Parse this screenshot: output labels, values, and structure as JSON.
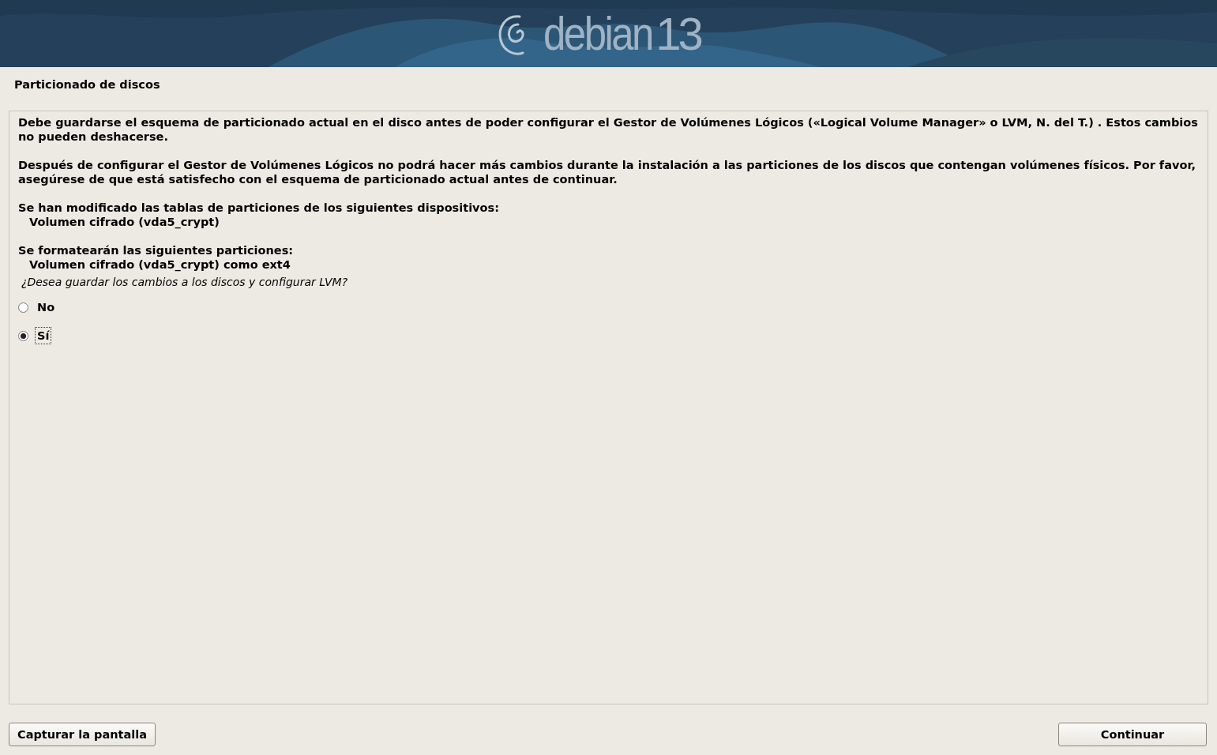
{
  "banner": {
    "brand": "debian",
    "version": "13"
  },
  "title": "Particionado de discos",
  "message": [
    {
      "kind": "paragraph",
      "text": "Debe guardarse el esquema de particionado actual en el disco antes de poder configurar el Gestor de Volúmenes Lógicos («Logical Volume Manager» o LVM, N. del T.) . Estos cambios no pueden deshacerse."
    },
    {
      "kind": "paragraph",
      "text": "Después de configurar el Gestor de Volúmenes Lógicos no podrá hacer más cambios durante la instalación a las particiones de los discos que contengan volúmenes físicos. Por favor, asegúrese de que está satisfecho con el esquema de particionado actual antes de continuar."
    },
    {
      "kind": "list_heading",
      "text": "Se han modificado las tablas de particiones de los siguientes dispositivos:"
    },
    {
      "kind": "list_item",
      "text": "Volumen cifrado (vda5_crypt)"
    },
    {
      "kind": "list_heading",
      "text": "Se formatearán las siguientes particiones:"
    },
    {
      "kind": "list_item",
      "text": "Volumen cifrado (vda5_crypt) como ext4"
    }
  ],
  "question": "¿Desea guardar los cambios a los discos y configurar LVM?",
  "options": [
    {
      "label": "No",
      "selected": false,
      "focused": false
    },
    {
      "label": "Sí",
      "selected": true,
      "focused": true
    }
  ],
  "buttons": {
    "left": "Capturar la pantalla",
    "right": "Continuar"
  }
}
